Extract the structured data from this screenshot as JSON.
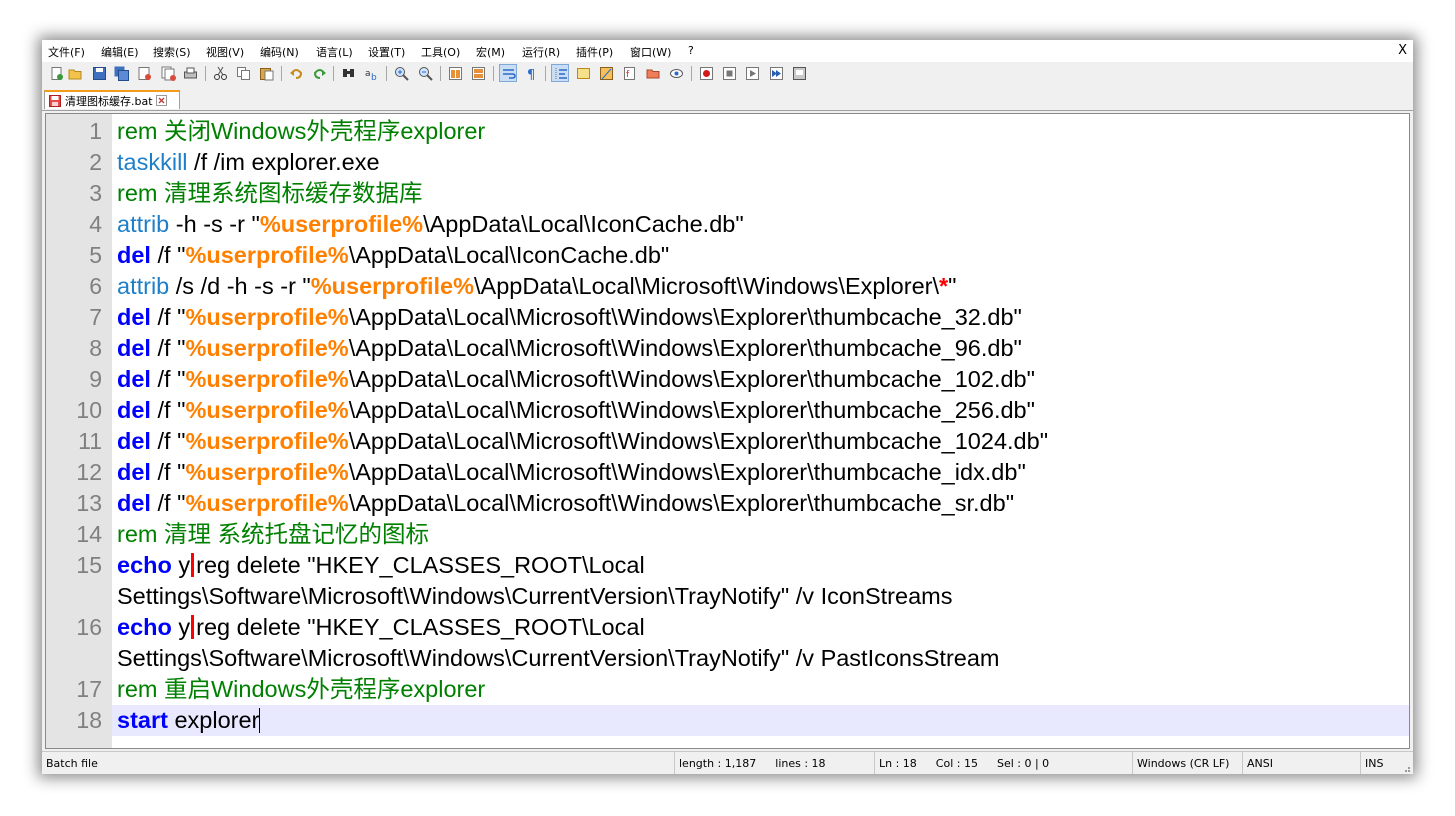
{
  "menu": {
    "items": [
      "文件(F)",
      "编辑(E)",
      "搜索(S)",
      "视图(V)",
      "编码(N)",
      "语言(L)",
      "设置(T)",
      "工具(O)",
      "宏(M)",
      "运行(R)",
      "插件(P)",
      "窗口(W)",
      "?"
    ],
    "close": "X"
  },
  "toolbar": {
    "buttons": [
      "new-file-icon",
      "open-file-icon",
      "save-icon",
      "save-all-icon",
      "close-icon",
      "close-all-icon",
      "print-icon",
      "cut-icon",
      "copy-icon",
      "paste-icon",
      "undo-icon",
      "redo-icon",
      "find-icon",
      "replace-icon",
      "zoom-in-icon",
      "zoom-out-icon",
      "sync-vertical-icon",
      "sync-horizontal-icon",
      "word-wrap-icon",
      "show-all-chars-icon",
      "indent-guide-icon",
      "udl-icon",
      "doc-map-icon",
      "function-list-icon",
      "folder-workspace-icon",
      "monitoring-icon",
      "record-macro-icon",
      "stop-macro-icon",
      "play-macro-icon",
      "run-macro-multiple-icon",
      "save-macro-icon"
    ]
  },
  "tab": {
    "label": "清理图标缓存.bat"
  },
  "editor": {
    "gutter": [
      "1",
      "2",
      "3",
      "4",
      "5",
      "6",
      "7",
      "8",
      "9",
      "10",
      "11",
      "12",
      "13",
      "14",
      "15",
      "",
      "16",
      "",
      "17",
      "18"
    ],
    "lines": [
      [
        {
          "t": "c",
          "s": "rem 关闭Windows外壳程序explorer"
        }
      ],
      [
        {
          "t": "m",
          "s": "taskkill"
        },
        {
          "t": "n",
          "s": " /f /im explorer.exe"
        }
      ],
      [
        {
          "t": "c",
          "s": "rem 清理系统图标缓存数据库"
        }
      ],
      [
        {
          "t": "m",
          "s": "attrib"
        },
        {
          "t": "n",
          "s": " -h -s -r \""
        },
        {
          "t": "v",
          "s": "%userprofile%"
        },
        {
          "t": "n",
          "s": "\\AppData\\Local\\IconCache.db\""
        }
      ],
      [
        {
          "t": "k",
          "s": "del"
        },
        {
          "t": "n",
          "s": " /f \""
        },
        {
          "t": "v",
          "s": "%userprofile%"
        },
        {
          "t": "n",
          "s": "\\AppData\\Local\\IconCache.db\""
        }
      ],
      [
        {
          "t": "m",
          "s": "attrib"
        },
        {
          "t": "n",
          "s": " /s /d -h -s -r \""
        },
        {
          "t": "v",
          "s": "%userprofile%"
        },
        {
          "t": "n",
          "s": "\\AppData\\Local\\Microsoft\\Windows\\Explorer\\"
        },
        {
          "t": "s",
          "s": "*"
        },
        {
          "t": "n",
          "s": "\""
        }
      ],
      [
        {
          "t": "k",
          "s": "del"
        },
        {
          "t": "n",
          "s": " /f \""
        },
        {
          "t": "v",
          "s": "%userprofile%"
        },
        {
          "t": "n",
          "s": "\\AppData\\Local\\Microsoft\\Windows\\Explorer\\thumbcache_32.db\""
        }
      ],
      [
        {
          "t": "k",
          "s": "del"
        },
        {
          "t": "n",
          "s": " /f \""
        },
        {
          "t": "v",
          "s": "%userprofile%"
        },
        {
          "t": "n",
          "s": "\\AppData\\Local\\Microsoft\\Windows\\Explorer\\thumbcache_96.db\""
        }
      ],
      [
        {
          "t": "k",
          "s": "del"
        },
        {
          "t": "n",
          "s": " /f \""
        },
        {
          "t": "v",
          "s": "%userprofile%"
        },
        {
          "t": "n",
          "s": "\\AppData\\Local\\Microsoft\\Windows\\Explorer\\thumbcache_102.db\""
        }
      ],
      [
        {
          "t": "k",
          "s": "del"
        },
        {
          "t": "n",
          "s": " /f \""
        },
        {
          "t": "v",
          "s": "%userprofile%"
        },
        {
          "t": "n",
          "s": "\\AppData\\Local\\Microsoft\\Windows\\Explorer\\thumbcache_256.db\""
        }
      ],
      [
        {
          "t": "k",
          "s": "del"
        },
        {
          "t": "n",
          "s": " /f \""
        },
        {
          "t": "v",
          "s": "%userprofile%"
        },
        {
          "t": "n",
          "s": "\\AppData\\Local\\Microsoft\\Windows\\Explorer\\thumbcache_1024.db\""
        }
      ],
      [
        {
          "t": "k",
          "s": "del"
        },
        {
          "t": "n",
          "s": " /f \""
        },
        {
          "t": "v",
          "s": "%userprofile%"
        },
        {
          "t": "n",
          "s": "\\AppData\\Local\\Microsoft\\Windows\\Explorer\\thumbcache_idx.db\""
        }
      ],
      [
        {
          "t": "k",
          "s": "del"
        },
        {
          "t": "n",
          "s": " /f \""
        },
        {
          "t": "v",
          "s": "%userprofile%"
        },
        {
          "t": "n",
          "s": "\\AppData\\Local\\Microsoft\\Windows\\Explorer\\thumbcache_sr.db\""
        }
      ],
      [
        {
          "t": "c",
          "s": "rem 清理 系统托盘记忆的图标"
        }
      ],
      [
        {
          "t": "k",
          "s": "echo"
        },
        {
          "t": "n",
          "s": " y"
        },
        {
          "t": "p",
          "s": "|"
        },
        {
          "t": "n",
          "s": "reg delete \"HKEY_CLASSES_ROOT\\Local"
        }
      ],
      [
        {
          "t": "n",
          "s": "Settings\\Software\\Microsoft\\Windows\\CurrentVersion\\TrayNotify\" /v IconStreams"
        }
      ],
      [
        {
          "t": "k",
          "s": "echo"
        },
        {
          "t": "n",
          "s": " y"
        },
        {
          "t": "p",
          "s": "|"
        },
        {
          "t": "n",
          "s": "reg delete \"HKEY_CLASSES_ROOT\\Local"
        }
      ],
      [
        {
          "t": "n",
          "s": "Settings\\Software\\Microsoft\\Windows\\CurrentVersion\\TrayNotify\" /v PastIconsStream"
        }
      ],
      [
        {
          "t": "c",
          "s": "rem 重启Windows外壳程序explorer"
        }
      ],
      [
        {
          "t": "k",
          "s": "start"
        },
        {
          "t": "n",
          "s": " explorer"
        }
      ]
    ],
    "current_line_index": 19
  },
  "status": {
    "file_type": "Batch file",
    "length": "length : 1,187",
    "lines": "lines : 18",
    "ln": "Ln : 18",
    "col": "Col : 15",
    "sel": "Sel : 0 | 0",
    "eol": "Windows (CR LF)",
    "encoding": "ANSI",
    "mode": "INS"
  },
  "colors": {
    "comment": "#008000",
    "command": "#1e7fc8",
    "keyword": "#0000ff",
    "variable": "#ff8000",
    "operator": "#ff0000",
    "current_line": "#e8e8ff",
    "tab_accent": "#f59b1b"
  }
}
